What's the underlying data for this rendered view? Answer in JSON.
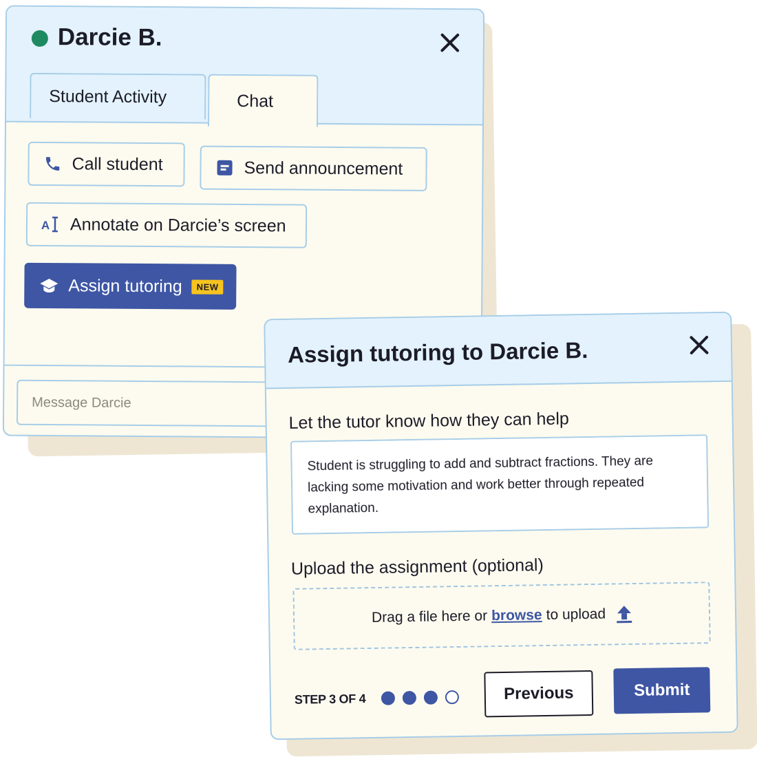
{
  "chat_panel": {
    "student_name": "Darcie B.",
    "status_color": "#1f8a62",
    "close_icon": "close-icon",
    "tabs": [
      {
        "label": "Student Activity",
        "active": false
      },
      {
        "label": "Chat",
        "active": true
      }
    ],
    "actions": {
      "call": {
        "label": "Call student",
        "icon": "phone-icon"
      },
      "announce": {
        "label": "Send announcement",
        "icon": "announcement-icon"
      },
      "annotate": {
        "label": "Annotate on Darcie’s screen",
        "icon": "annotate-icon"
      },
      "assign": {
        "label": "Assign tutoring",
        "icon": "graduation-cap-icon",
        "badge": "NEW"
      }
    },
    "message_placeholder": "Message Darcie"
  },
  "tutoring_modal": {
    "title": "Assign tutoring to Darcie B.",
    "close_icon": "close-icon",
    "help_label": "Let the tutor know how they can help",
    "help_text": "Student is struggling to add and subtract fractions. They are lacking some motivation and work better through repeated explanation.",
    "upload_label": "Upload the assignment (optional)",
    "dropzone": {
      "before": "Drag a file here or",
      "link": "browse",
      "after": "to upload",
      "icon": "upload-icon"
    },
    "step_text": "STEP 3 OF 4",
    "step_current": 3,
    "step_total": 4,
    "previous_label": "Previous",
    "submit_label": "Submit"
  },
  "colors": {
    "accent": "#3e56a4",
    "header_bg": "#e3f2fc",
    "border": "#a7cde8",
    "card_bg": "#fdfbef",
    "badge": "#f6c31f"
  }
}
